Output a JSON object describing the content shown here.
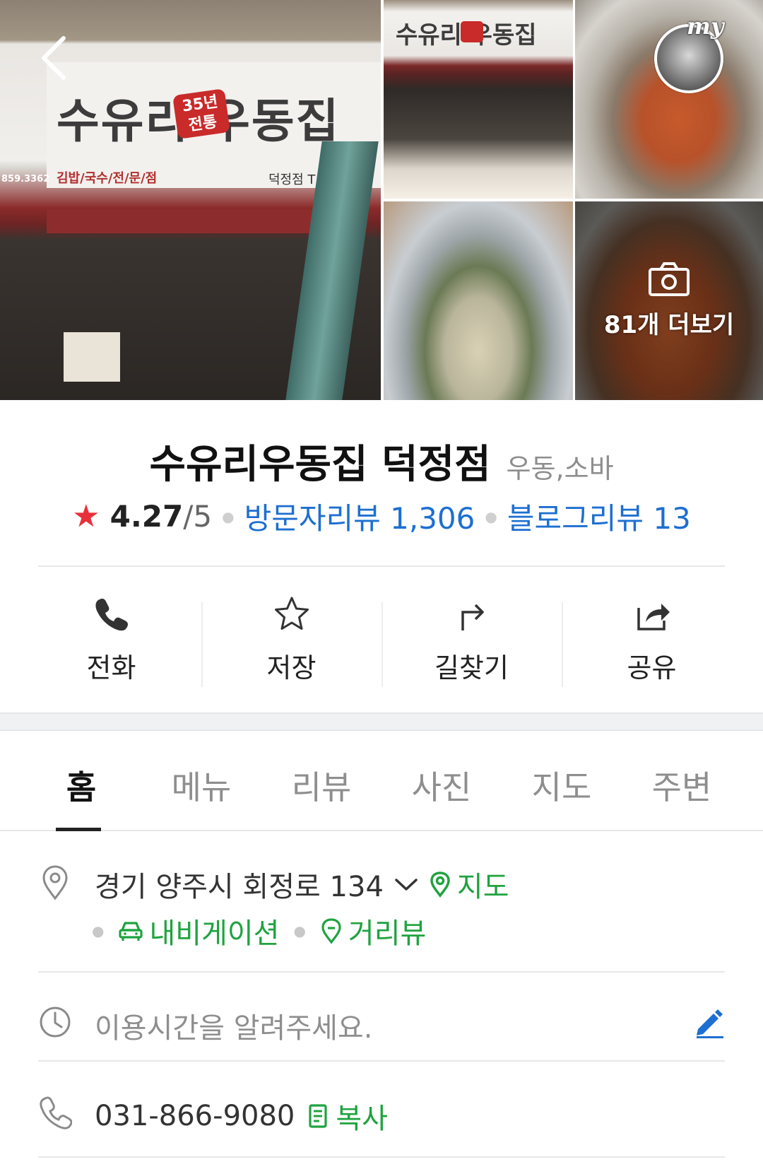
{
  "gallery": {
    "more_photos_label": "81개 더보기",
    "profile_badge": "my",
    "sign_main": "수유리 우동집",
    "sign_stamp": "35년 전통",
    "sign_sub": "김밥/국수/전/문/점",
    "sign_branch": "덕정점 T",
    "sign_phone": "859.3362"
  },
  "place": {
    "name": "수유리우동집 덕정점",
    "category": "우동,소바",
    "rating": "4.27",
    "rating_max": "/5",
    "visitor_reviews": "방문자리뷰 1,306",
    "blog_reviews": "블로그리뷰 13"
  },
  "actions": [
    {
      "label": "전화",
      "icon": "phone-icon"
    },
    {
      "label": "저장",
      "icon": "star-icon"
    },
    {
      "label": "길찾기",
      "icon": "directions-icon"
    },
    {
      "label": "공유",
      "icon": "share-icon"
    }
  ],
  "tabs": [
    "홈",
    "메뉴",
    "리뷰",
    "사진",
    "지도",
    "주변"
  ],
  "active_tab": "홈",
  "info": {
    "address": "경기 양주시 회정로 134",
    "map_link": "지도",
    "navigation_link": "내비게이션",
    "roadview_link": "거리뷰",
    "hours_placeholder": "이용시간을 알려주세요.",
    "phone": "031-866-9080",
    "copy_label": "복사"
  },
  "colors": {
    "link_blue": "#1d6fd1",
    "link_green": "#1fa33f",
    "star_red": "#e8303a",
    "edit_blue": "#1d6fd1"
  }
}
